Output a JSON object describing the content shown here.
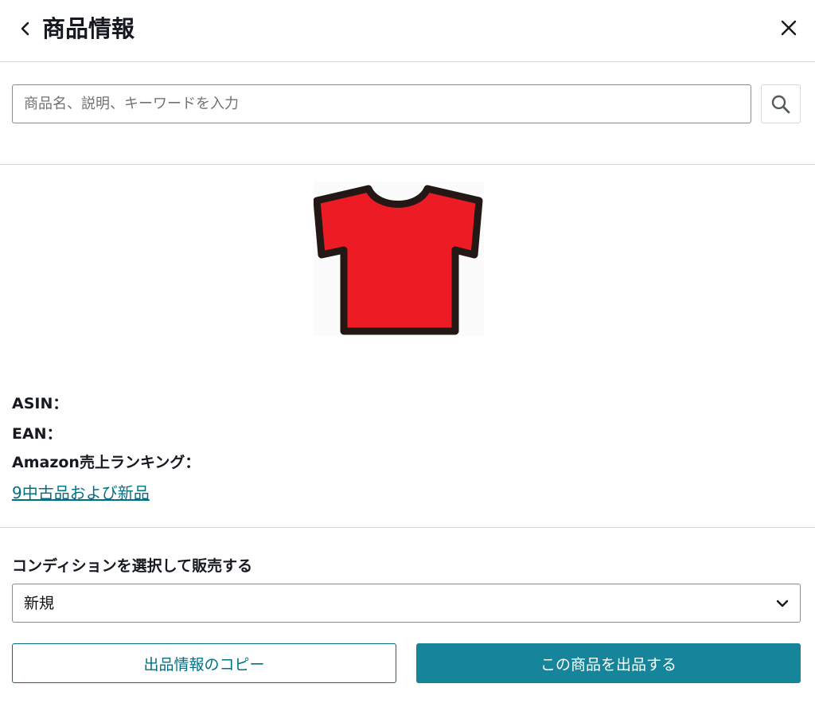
{
  "header": {
    "title": "商品情報",
    "back_icon": "chevron-left-icon",
    "close_icon": "close-icon"
  },
  "search": {
    "placeholder": "商品名、説明、キーワードを入力",
    "value": "",
    "icon": "search-icon"
  },
  "product": {
    "image": "red-tshirt-image",
    "image_color": "#ed1c24",
    "asin_label": "ASIN：",
    "ean_label": "EAN：",
    "ranking_label": "Amazon売上ランキング：",
    "offers_link": "9中古品および新品"
  },
  "condition": {
    "label": "コンディションを選択して販売する",
    "selected": "新規",
    "icon": "chevron-down-icon"
  },
  "actions": {
    "copy_label": "出品情報のコピー",
    "list_label": "この商品を出品する"
  },
  "colors": {
    "accent": "#007185",
    "primary_button": "#16849a",
    "divider": "#d5d9d9"
  }
}
